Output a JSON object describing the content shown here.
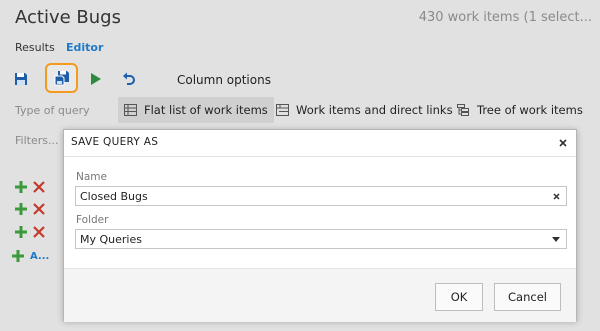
{
  "header": {
    "title": "Active Bugs",
    "count": "430 work items (1 select..."
  },
  "tabs": {
    "results": "Results",
    "editor": "Editor"
  },
  "toolbar": {
    "column_options": "Column options"
  },
  "query_type": {
    "label": "Type of query",
    "options": [
      "Flat list of work items",
      "Work items and direct links",
      "Tree of work items"
    ],
    "selected": "Flat list of work items"
  },
  "filters": {
    "label": "Filters...",
    "add_clause_link": "A..."
  },
  "dialog": {
    "title": "SAVE QUERY AS",
    "name_label": "Name",
    "name_value": "Closed Bugs",
    "folder_label": "Folder",
    "folder_value": "My Queries",
    "ok_label": "OK",
    "cancel_label": "Cancel"
  },
  "colors": {
    "accent": "#1e7ac8",
    "highlight": "#f39a1f",
    "add_green": "#3c9a3c",
    "delete_red": "#c23a2c",
    "run_green": "#2e8b3e"
  }
}
